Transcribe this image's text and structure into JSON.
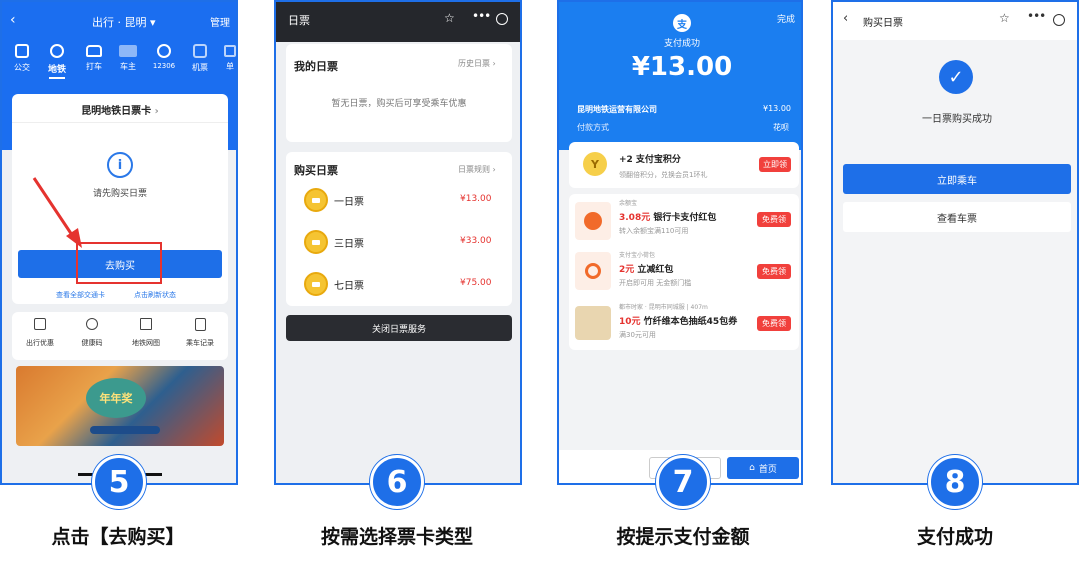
{
  "steps": [
    {
      "number": "5",
      "caption": "点击【去购买】"
    },
    {
      "number": "6",
      "caption": "按需选择票卡类型"
    },
    {
      "number": "7",
      "caption": "按提示支付金额"
    },
    {
      "number": "8",
      "caption": "支付成功"
    }
  ],
  "p5": {
    "header_title": "出行 · 昆明 ▾",
    "header_action": "管理",
    "nav": [
      "公交",
      "地铁",
      "打车",
      "车主",
      "12306",
      "机票",
      "单"
    ],
    "card_title": "昆明地铁日票卡",
    "info_icon": "i",
    "prompt": "请先购买日票",
    "buy_button": "去购买",
    "link_left": "查看全部交通卡",
    "link_right": "点击刷新状态",
    "services": [
      "出行优惠",
      "健康码",
      "地铁网图",
      "乘车记录"
    ],
    "banner_title": "年年奖"
  },
  "p6": {
    "title": "日票",
    "my_title": "我的日票",
    "history": "历史日票",
    "empty_text": "暂无日票，购买后可享受乘车优惠",
    "buy_title": "购买日票",
    "rules": "日票规则",
    "tickets": [
      {
        "name": "一日票",
        "price": "¥13.00"
      },
      {
        "name": "三日票",
        "price": "¥33.00"
      },
      {
        "name": "七日票",
        "price": "¥75.00"
      }
    ],
    "close_button": "关闭日票服务"
  },
  "p7": {
    "done": "完成",
    "status": "支付成功",
    "amount": "¥13.00",
    "merchant": "昆明地铁运营有限公司",
    "merchant_amount": "¥13.00",
    "pay_method_label": "付款方式",
    "pay_method": "花呗",
    "points_title": "+2 支付宝积分",
    "points_sub": "领翻倍积分，兑换会员1环礼",
    "points_btn": "立即领",
    "offers": [
      {
        "tag": "余额宝",
        "amount": "3.08元",
        "title": "银行卡支付红包",
        "sub": "转入余额宝满110可用",
        "btn": "免费领"
      },
      {
        "tag": "支付宝小荷包",
        "amount": "2元",
        "title": "立减红包",
        "sub": "开启即可用 无金额门槛",
        "btn": "免费领"
      },
      {
        "tag": "都市时家 · 昆明市同城服 | 407m",
        "amount": "10元",
        "title": "竹纤维本色抽纸45包券",
        "sub": "满30元可用",
        "btn": "免费领"
      }
    ],
    "home_btn": "首页"
  },
  "p8": {
    "title": "购买日票",
    "success_text": "一日票购买成功",
    "ride_button": "立即乘车",
    "view_button": "查看车票"
  },
  "colors": {
    "brand": "#1e6fe8",
    "danger": "#f1403c",
    "gold": "#f5c432"
  }
}
